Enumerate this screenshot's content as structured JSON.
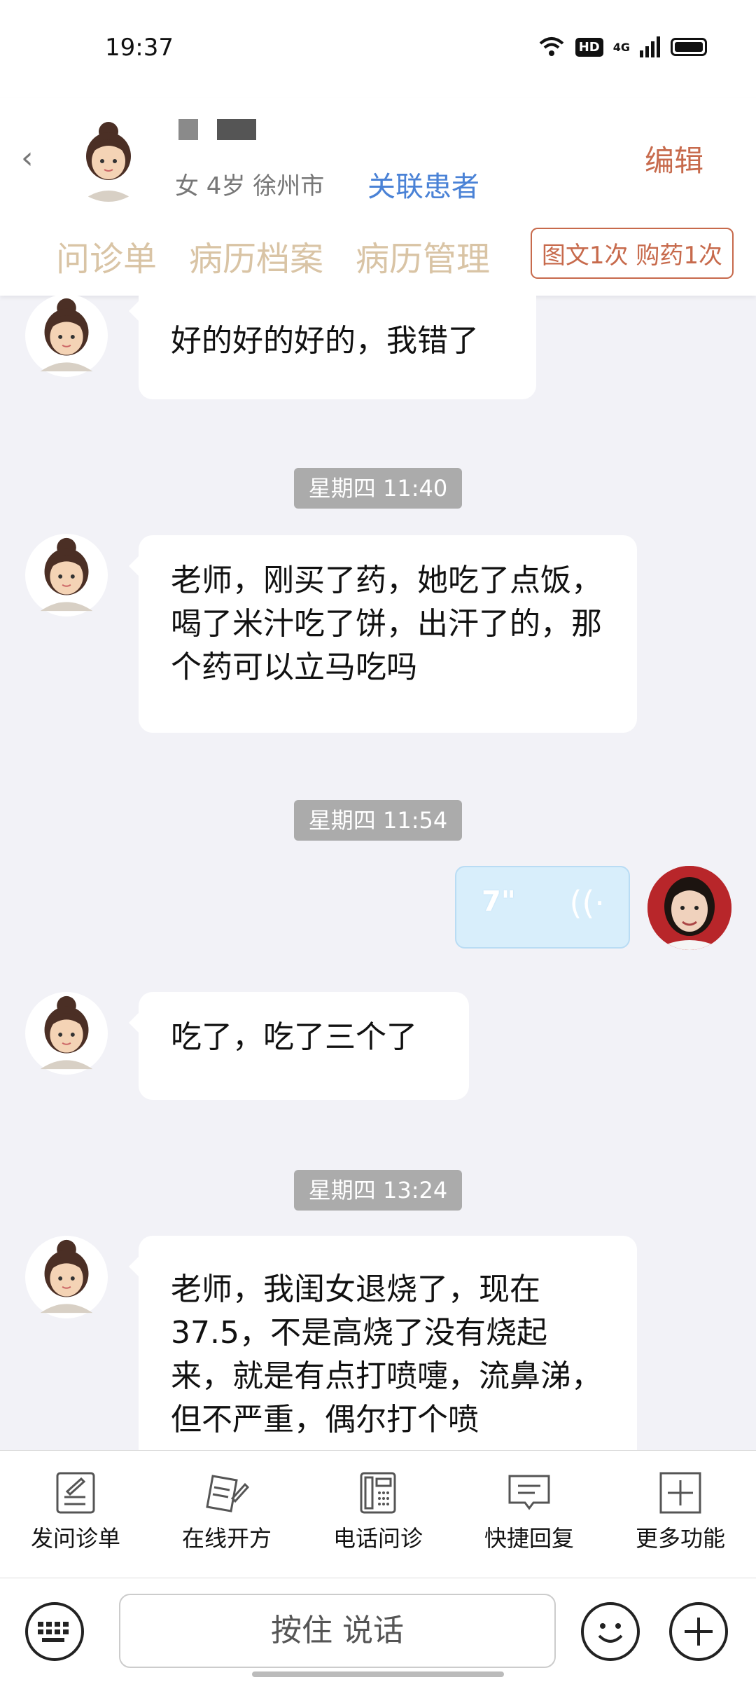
{
  "status_bar": {
    "time": "19:37",
    "hd": "HD",
    "net": "4G"
  },
  "header": {
    "patient_meta": "女 4岁  徐州市",
    "link_label": "关联患者",
    "edit_label": "编辑",
    "tabs": [
      "问诊单",
      "病历档案",
      "病历管理"
    ],
    "quota": "图文1次 购药1次"
  },
  "chat": {
    "messages": [
      {
        "text": "好的好的好的，我错了"
      },
      {
        "time": "星期四 11:40"
      },
      {
        "text": "老师，刚买了药，她吃了点饭，喝了米汁吃了饼，出汗了的，那个药可以立马吃吗"
      },
      {
        "time": "星期四 11:54"
      },
      {
        "voice_duration": "7\""
      },
      {
        "text": "吃了，吃了三个了"
      },
      {
        "time": "星期四 13:24"
      },
      {
        "text": "老师，我闺女退烧了，现在37.5，不是高烧了没有烧起来，就是有点打喷嚏，流鼻涕，但不严重，偶尔打个喷"
      }
    ]
  },
  "toolbar": {
    "items": [
      {
        "label": "发问诊单",
        "icon": "form-icon"
      },
      {
        "label": "在线开方",
        "icon": "prescription-icon"
      },
      {
        "label": "电话问诊",
        "icon": "phone-icon"
      },
      {
        "label": "快捷回复",
        "icon": "reply-icon"
      },
      {
        "label": "更多功能",
        "icon": "plus-box-icon"
      }
    ]
  },
  "input": {
    "hold_to_talk": "按住 说话"
  },
  "colors": {
    "accent_blue": "#4a82d6",
    "accent_red": "#c76a4c",
    "tab_tan": "#d9c4a5"
  }
}
